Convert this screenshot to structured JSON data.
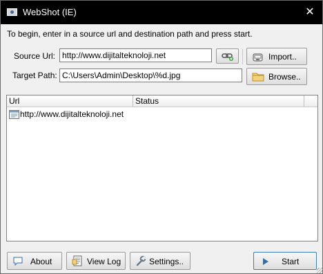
{
  "window": {
    "title": "WebShot (IE)"
  },
  "instructions": "To begin, enter in a source url and destination path and press start.",
  "source": {
    "label": "Source Url:",
    "value": "http://www.dijitalteknoloji.net"
  },
  "target": {
    "label": "Target Path:",
    "value": "C:\\Users\\Admin\\Desktop\\%d.jpg"
  },
  "buttons": {
    "import": "Import..",
    "browse": "Browse..",
    "about": "About",
    "viewlog": "View Log",
    "settings": "Settings..",
    "start": "Start"
  },
  "list": {
    "columns": [
      "Url",
      "Status"
    ],
    "rows": [
      {
        "url": "http://www.dijitalteknoloji.net",
        "status": ""
      }
    ]
  },
  "icons": {
    "app": "camera-icon",
    "close": "close-icon",
    "link": "link-icon",
    "import": "import-icon",
    "browse": "folder-icon",
    "about": "speech-bubble-icon",
    "viewlog": "log-icon",
    "settings": "wrench-icon",
    "start": "play-icon",
    "row": "webpage-icon"
  }
}
